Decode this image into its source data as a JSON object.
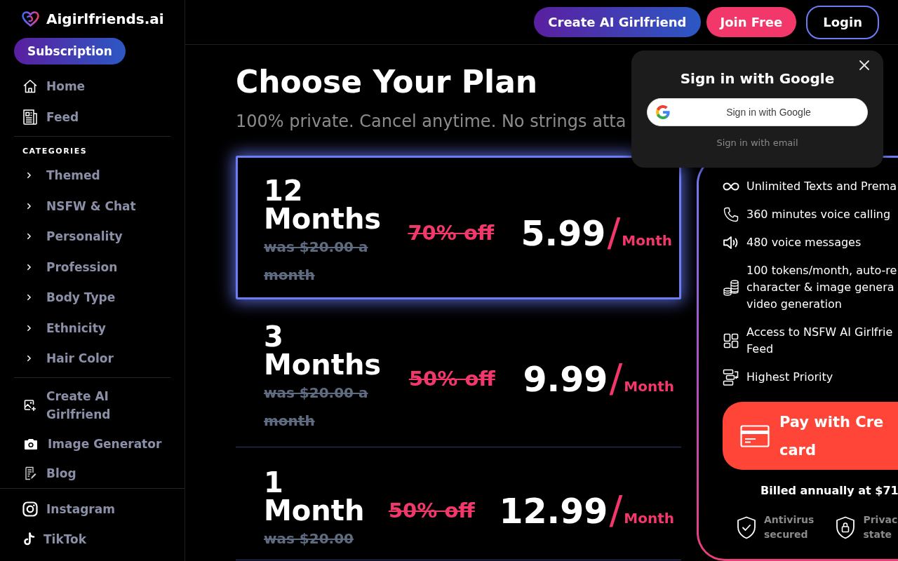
{
  "sidebar": {
    "brand": "Aigirlfriends.ai",
    "subscription_button": "Subscription",
    "main_links": [
      "Home",
      "Feed"
    ],
    "categories_heading": "CATEGORIES",
    "categories": [
      {
        "label": "Themed",
        "expanded": false
      },
      {
        "label": "NSFW & Chat",
        "expanded": false
      },
      {
        "label": "Personality",
        "expanded": false
      },
      {
        "label": "Profession",
        "expanded": false
      },
      {
        "label": "Body Type",
        "expanded": false
      },
      {
        "label": "Ethnicity",
        "expanded": false
      },
      {
        "label": "Hair Color",
        "expanded": false
      }
    ],
    "tool_links": [
      "Create AI Girlfriend",
      "Image Generator",
      "Blog"
    ],
    "social_links": [
      "Instagram",
      "TikTok"
    ]
  },
  "header": {
    "buttons": [
      {
        "label": "Create AI Girlfriend",
        "kind": "gradient"
      },
      {
        "label": "Join Free",
        "kind": "filled"
      },
      {
        "label": "Login",
        "kind": "outline"
      }
    ]
  },
  "plans_section": {
    "title": "Choose Your Plan",
    "subtitle": "100% private. Cancel anytime. No strings atta",
    "plans": [
      {
        "duration": "12 Months",
        "was_price": "was $20.00 a month",
        "discount": "70% off",
        "price": "5.99",
        "separator": "/",
        "unit": "Month",
        "selected": true
      },
      {
        "duration": "3 Months",
        "was_price": "was $20.00 a month",
        "discount": "50% off",
        "price": "9.99",
        "separator": "/",
        "unit": "Month",
        "selected": false
      },
      {
        "duration": "1 Month",
        "was_price": "was $20.00",
        "discount": "50% off",
        "price": "12.99",
        "separator": "/",
        "unit": "Month",
        "selected": false
      }
    ]
  },
  "benefits_panel": {
    "features": [
      "Unlimited Texts and Prema",
      "360 minutes voice calling",
      "480 voice messages",
      "100 tokens/month, auto-re\ncharacter & image genera\nvideo generation",
      "Access to NSFW AI Girlfrie\nFeed",
      "Highest Priority"
    ],
    "pay_button": "Pay with Cre\ncard",
    "billing_note": "Billed annually at $71",
    "trust_badges": [
      "Antivirus secured",
      "Privac state"
    ]
  },
  "google_popup": {
    "title": "Sign in with Google",
    "google_button": "Sign in with Google",
    "email_link": "Sign in with email"
  }
}
